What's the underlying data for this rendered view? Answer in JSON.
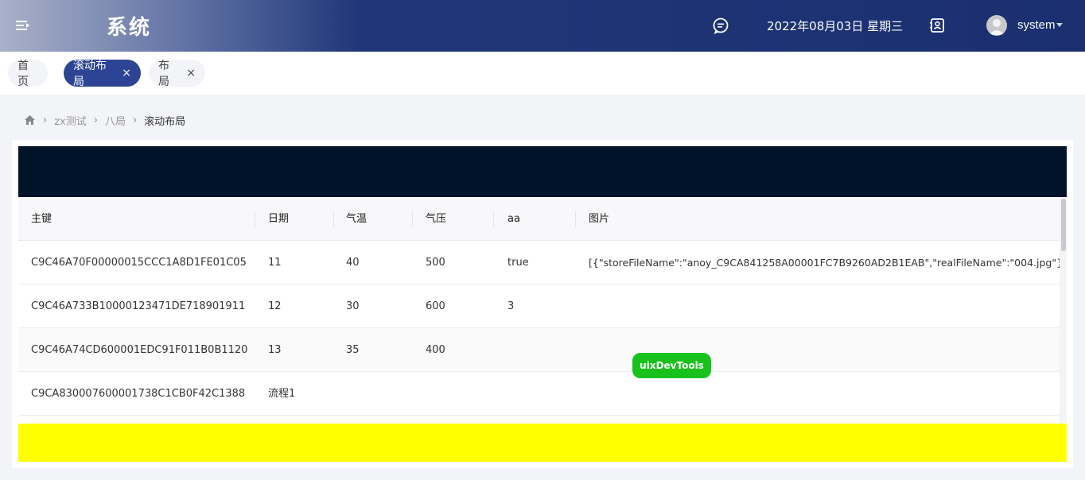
{
  "header": {
    "title": "系统",
    "date": "2022年08月03日 星期三",
    "user": "system",
    "icons": [
      "menu-toggle-icon",
      "message-icon",
      "contact-card-icon",
      "avatar-icon",
      "chevron-down-icon"
    ]
  },
  "tabs": [
    {
      "label": "首页",
      "active": false,
      "closable": false
    },
    {
      "label": "滚动布局",
      "active": true,
      "closable": true
    },
    {
      "label": "布局",
      "active": false,
      "closable": true
    }
  ],
  "tab_close_glyph": "×",
  "breadcrumb": {
    "separator": "›",
    "items": [
      "zx测试",
      "八局",
      "滚动布局"
    ]
  },
  "table": {
    "columns": [
      "主键",
      "日期",
      "气温",
      "气压",
      "aa",
      "图片"
    ],
    "rows": [
      [
        "C9C46A70F00000015CCC1A8D1FE01C05",
        "11",
        "40",
        "500",
        "true",
        "[{\"storeFileName\":\"anoy_C9CA841258A00001FC7B9260AD2B1EAB\",\"realFileName\":\"004.jpg\"}]"
      ],
      [
        "C9C46A733B10000123471DE718901911",
        "12",
        "30",
        "600",
        "3",
        ""
      ],
      [
        "C9C46A74CD600001EDC91F011B0B1120",
        "13",
        "35",
        "400",
        "",
        ""
      ],
      [
        "C9CA830007600001738C1CB0F42C1388",
        "流程1",
        "",
        "",
        "",
        ""
      ]
    ]
  },
  "devtools_label": "uixDevTools",
  "colors": {
    "header_dark": "#1b2f70",
    "active_tab": "#2c4493",
    "dark_band": "#001329",
    "yellow_band": "#ffff00",
    "devtools": "#19c11d"
  }
}
